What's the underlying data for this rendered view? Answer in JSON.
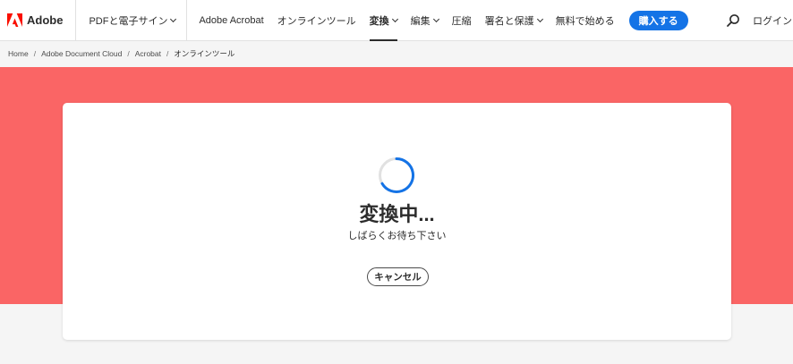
{
  "header": {
    "brand": "Adobe",
    "nav": {
      "pdf_sign": "PDFと電子サイン",
      "acrobat": "Adobe Acrobat",
      "online_tools": "オンラインツール",
      "convert": "変換",
      "edit": "編集",
      "compress": "圧縮",
      "sign_protect": "署名と保護",
      "free_start": "無料で始める"
    },
    "buy_label": "購入する",
    "login_label": "ログイン",
    "icons": {
      "logo": "adobe-logo",
      "search": "search-icon"
    },
    "colors": {
      "logo": "#fa0f00",
      "buy_button": "#1473e6"
    }
  },
  "breadcrumb": {
    "items": [
      "Home",
      "Adobe Document Cloud",
      "Acrobat",
      "オンラインツール"
    ]
  },
  "hero": {
    "background": "#fa6565"
  },
  "dialog": {
    "title": "変換中...",
    "subtitle": "しばらくお待ち下さい",
    "cancel_label": "キャンセル",
    "spinner": {
      "icon": "loading-spinner",
      "color": "#1473e6"
    }
  }
}
